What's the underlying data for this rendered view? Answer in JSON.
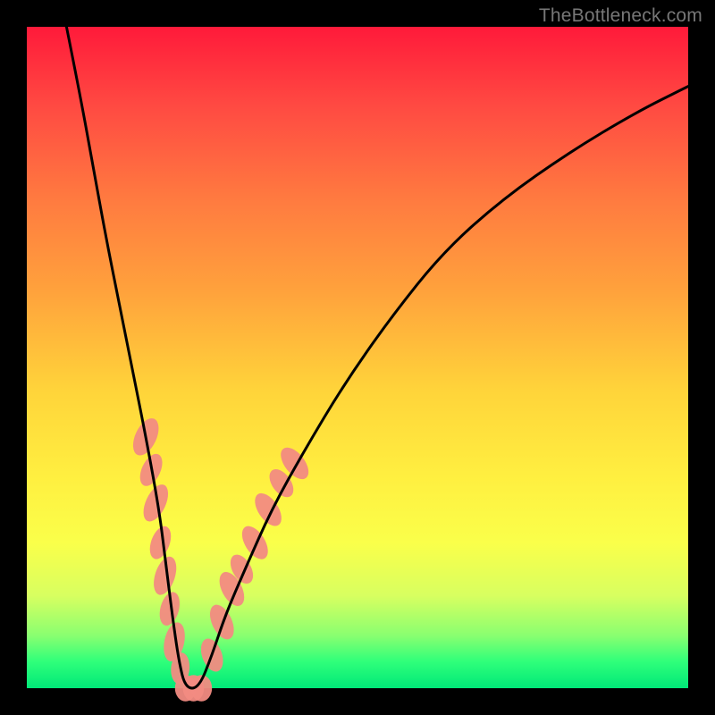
{
  "watermark": "TheBottleneck.com",
  "chart_data": {
    "type": "line",
    "title": "",
    "xlabel": "",
    "ylabel": "",
    "xlim": [
      0,
      100
    ],
    "ylim": [
      0,
      100
    ],
    "grid": false,
    "legend": false,
    "background_gradient": {
      "top": "#ff1a3a",
      "bottom": "#00e878"
    },
    "series": [
      {
        "name": "bottleneck-curve",
        "color": "#000000",
        "x": [
          6,
          8,
          10,
          12,
          14,
          16,
          18,
          20,
          21,
          22,
          23,
          24,
          26,
          28,
          30,
          33,
          37,
          42,
          48,
          55,
          63,
          72,
          82,
          92,
          100
        ],
        "values": [
          100,
          90,
          79,
          68,
          58,
          48,
          38,
          27,
          19,
          11,
          4,
          0,
          0,
          5,
          11,
          18,
          27,
          36,
          46,
          56,
          66,
          74,
          81,
          87,
          91
        ]
      }
    ],
    "annotations": [
      {
        "name": "salmon-blobs",
        "type": "ellipses",
        "color": "#f28b82",
        "points": [
          {
            "x": 18.0,
            "y": 38,
            "rx": 1.6,
            "ry": 3.0,
            "rot": 25
          },
          {
            "x": 18.8,
            "y": 33,
            "rx": 1.4,
            "ry": 2.6,
            "rot": 25
          },
          {
            "x": 19.5,
            "y": 28,
            "rx": 1.5,
            "ry": 3.0,
            "rot": 25
          },
          {
            "x": 20.2,
            "y": 22,
            "rx": 1.4,
            "ry": 2.6,
            "rot": 20
          },
          {
            "x": 20.9,
            "y": 17,
            "rx": 1.5,
            "ry": 3.0,
            "rot": 18
          },
          {
            "x": 21.6,
            "y": 12,
            "rx": 1.4,
            "ry": 2.6,
            "rot": 15
          },
          {
            "x": 22.3,
            "y": 7,
            "rx": 1.5,
            "ry": 3.0,
            "rot": 12
          },
          {
            "x": 23.2,
            "y": 3,
            "rx": 1.4,
            "ry": 2.4,
            "rot": 5
          },
          {
            "x": 24.0,
            "y": 0,
            "rx": 1.6,
            "ry": 2.0,
            "rot": 0
          },
          {
            "x": 25.2,
            "y": 0,
            "rx": 1.6,
            "ry": 2.0,
            "rot": 0
          },
          {
            "x": 26.4,
            "y": 0,
            "rx": 1.6,
            "ry": 2.0,
            "rot": 0
          },
          {
            "x": 28.0,
            "y": 5,
            "rx": 1.5,
            "ry": 2.6,
            "rot": -20
          },
          {
            "x": 29.5,
            "y": 10,
            "rx": 1.5,
            "ry": 2.8,
            "rot": -25
          },
          {
            "x": 31.0,
            "y": 15,
            "rx": 1.5,
            "ry": 2.8,
            "rot": -28
          },
          {
            "x": 32.5,
            "y": 18,
            "rx": 1.4,
            "ry": 2.4,
            "rot": -30
          },
          {
            "x": 34.5,
            "y": 22,
            "rx": 1.5,
            "ry": 2.8,
            "rot": -32
          },
          {
            "x": 36.5,
            "y": 27,
            "rx": 1.5,
            "ry": 2.8,
            "rot": -34
          },
          {
            "x": 38.5,
            "y": 31,
            "rx": 1.4,
            "ry": 2.4,
            "rot": -36
          },
          {
            "x": 40.5,
            "y": 34,
            "rx": 1.5,
            "ry": 2.8,
            "rot": -38
          }
        ]
      }
    ]
  }
}
